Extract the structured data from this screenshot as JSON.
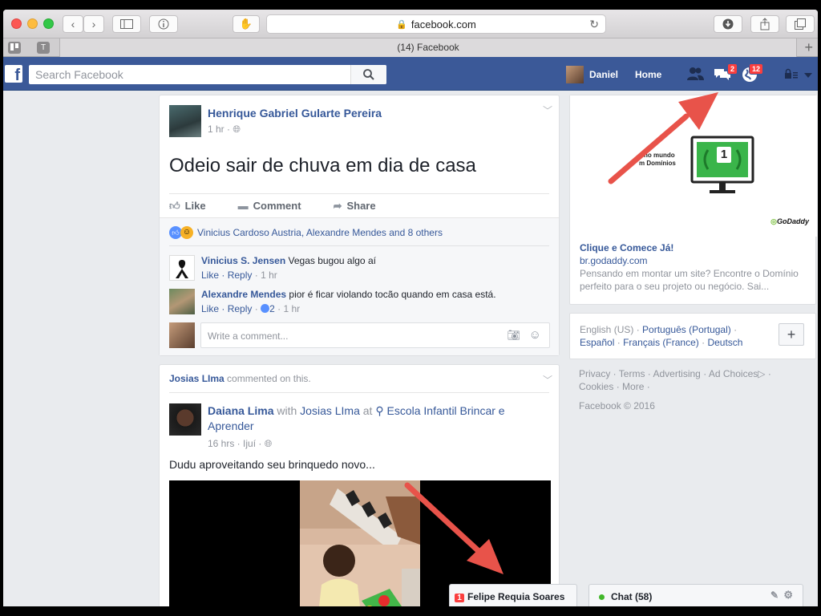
{
  "browser": {
    "url": "facebook.com",
    "tab_title": "(14) Facebook",
    "pinned_tab_1": "",
    "pinned_tab_2": "T"
  },
  "fb_header": {
    "logo": "f",
    "search_placeholder": "Search Facebook",
    "profile_name": "Daniel",
    "home_label": "Home",
    "messages_badge": "2",
    "notifications_badge": "12"
  },
  "post1": {
    "author": "Henrique Gabriel Gularte Pereira",
    "time": "1 hr · ",
    "text": "Odeio sair de chuva em dia de casa",
    "like": "Like",
    "comment": "Comment",
    "share": "Share",
    "reactions": "Vinicius Cardoso Austria, Alexandre Mendes and 8 others",
    "comments": [
      {
        "author": "Vinicius S. Jensen",
        "text": "Vegas bugou algo aí",
        "like": "Like",
        "reply": "Reply",
        "time": "1 hr"
      },
      {
        "author": "Alexandre Mendes",
        "text": "pior é ficar violando tocão quando em casa está.",
        "like": "Like",
        "reply": "Reply",
        "likes_count": "2",
        "time": "1 hr"
      }
    ],
    "write_placeholder": "Write a comment..."
  },
  "post2": {
    "header_name": "Josias LIma",
    "header_action": "commented on this.",
    "author": "Daiana Lima",
    "with_word": "with",
    "with_name": "Josias LIma",
    "at_word": "at",
    "place": "Escola Infantil Brincar e Aprender",
    "time": "16 hrs · Ijuí · ",
    "text": "Dudu aproveitando seu brinquedo novo..."
  },
  "ad": {
    "image_text_1": "no mundo",
    "image_text_2": "m Domínios",
    "monitor_number": "1",
    "brand": "GoDaddy",
    "title": "Clique e Comece Já!",
    "domain": "br.godaddy.com",
    "desc": "Pensando em montar um site? Encontre o Domínio perfeito para o seu projeto ou negócio. Sai..."
  },
  "languages": {
    "current": "English (US)",
    "items": [
      "Português (Portugal)",
      "Español",
      "Français (France)",
      "Deutsch"
    ],
    "plus": "+"
  },
  "footer": {
    "links_line1": [
      "Privacy",
      "Terms",
      "Advertising",
      "Ad Choices"
    ],
    "links_line2": [
      "Cookies",
      "More"
    ],
    "copyright": "Facebook © 2016"
  },
  "chat": {
    "conv_badge": "1",
    "conv_name": "Felipe Requia Soares",
    "chat_label": "Chat (58)"
  },
  "colors": {
    "fb_blue": "#3b5998",
    "link_blue": "#365899",
    "arrow_red": "#e8534a",
    "badge_red": "#fa3e3e",
    "chat_green": "#42b72a"
  }
}
